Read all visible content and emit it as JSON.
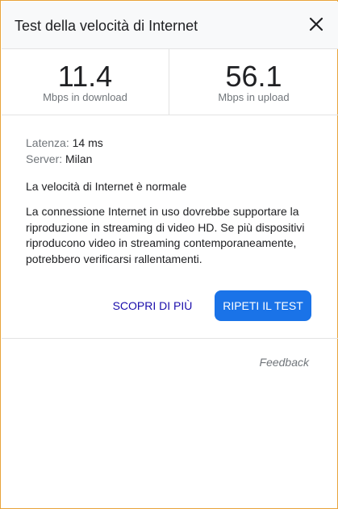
{
  "header": {
    "title": "Test della velocità di Internet",
    "close_icon": "close-icon"
  },
  "results": {
    "download": {
      "value": "11.4",
      "unit": "Mbps in download"
    },
    "upload": {
      "value": "56.1",
      "unit": "Mbps in upload"
    }
  },
  "details": {
    "latency_label": "Latenza:",
    "latency_value": "14 ms",
    "server_label": "Server:",
    "server_value": "Milan"
  },
  "status": "La velocità di Internet è normale",
  "description": "La connessione Internet in uso dovrebbe supportare la riproduzione in streaming di video HD. Se più dispositivi riproducono video in streaming contemporaneamente, potrebbero verificarsi rallentamenti.",
  "actions": {
    "learn_more": "SCOPRI DI PIÙ",
    "retest": "RIPETI IL TEST"
  },
  "footer": {
    "feedback": "Feedback"
  },
  "colors": {
    "accent": "#1a73e8",
    "link": "#1a0dab",
    "frame_border": "#e8a33a"
  }
}
